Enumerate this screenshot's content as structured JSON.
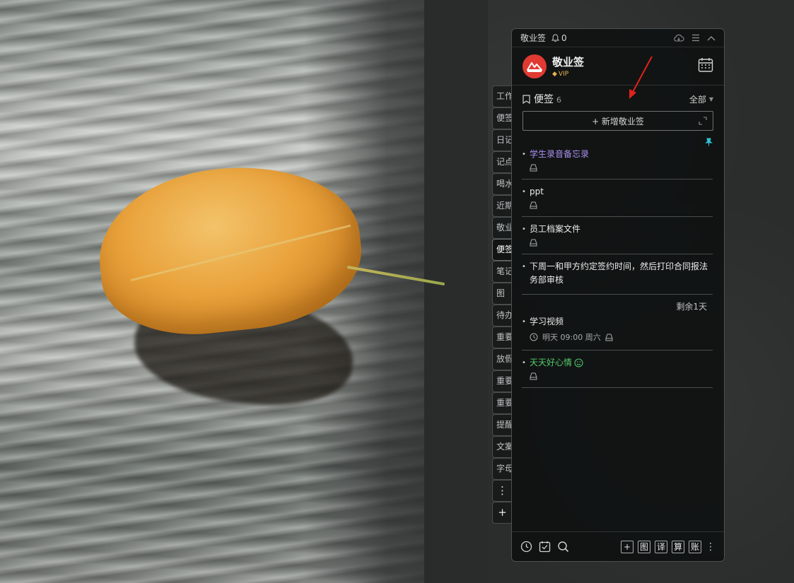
{
  "app": {
    "title": "敬业签",
    "notification_count": "0"
  },
  "profile": {
    "name": "敬业签",
    "badge": "VIP"
  },
  "side_tabs": [
    "工作",
    "便签",
    "日记",
    "记点",
    "喝水",
    "近期",
    "敬业",
    "便签",
    "笔记",
    "图",
    "待办",
    "重要",
    "放假",
    "重要",
    "重要",
    "提醒",
    "文案",
    "字母"
  ],
  "list": {
    "title": "便签",
    "count": "6",
    "filter": "全部",
    "add_label": "+ 新增敬业签"
  },
  "notes": [
    {
      "text": "学生录音备忘录"
    },
    {
      "text": "ppt"
    },
    {
      "text": "员工档案文件"
    },
    {
      "text": "下周一和甲方约定签约时间，然后打印合同报法务部审核"
    },
    {
      "remaining": "剩余1天",
      "text": "学习视频",
      "reminder": "明天 09:00 周六"
    },
    {
      "text": "天天好心情"
    }
  ],
  "footer": {
    "tools": [
      "图",
      "译",
      "算",
      "账"
    ]
  },
  "colors": {
    "accent_purple": "#a98ff0",
    "accent_green": "#56c96a",
    "pin_cyan": "#2ec4d6",
    "logo_red": "#e03a32",
    "vip_gold": "#e6b450"
  }
}
